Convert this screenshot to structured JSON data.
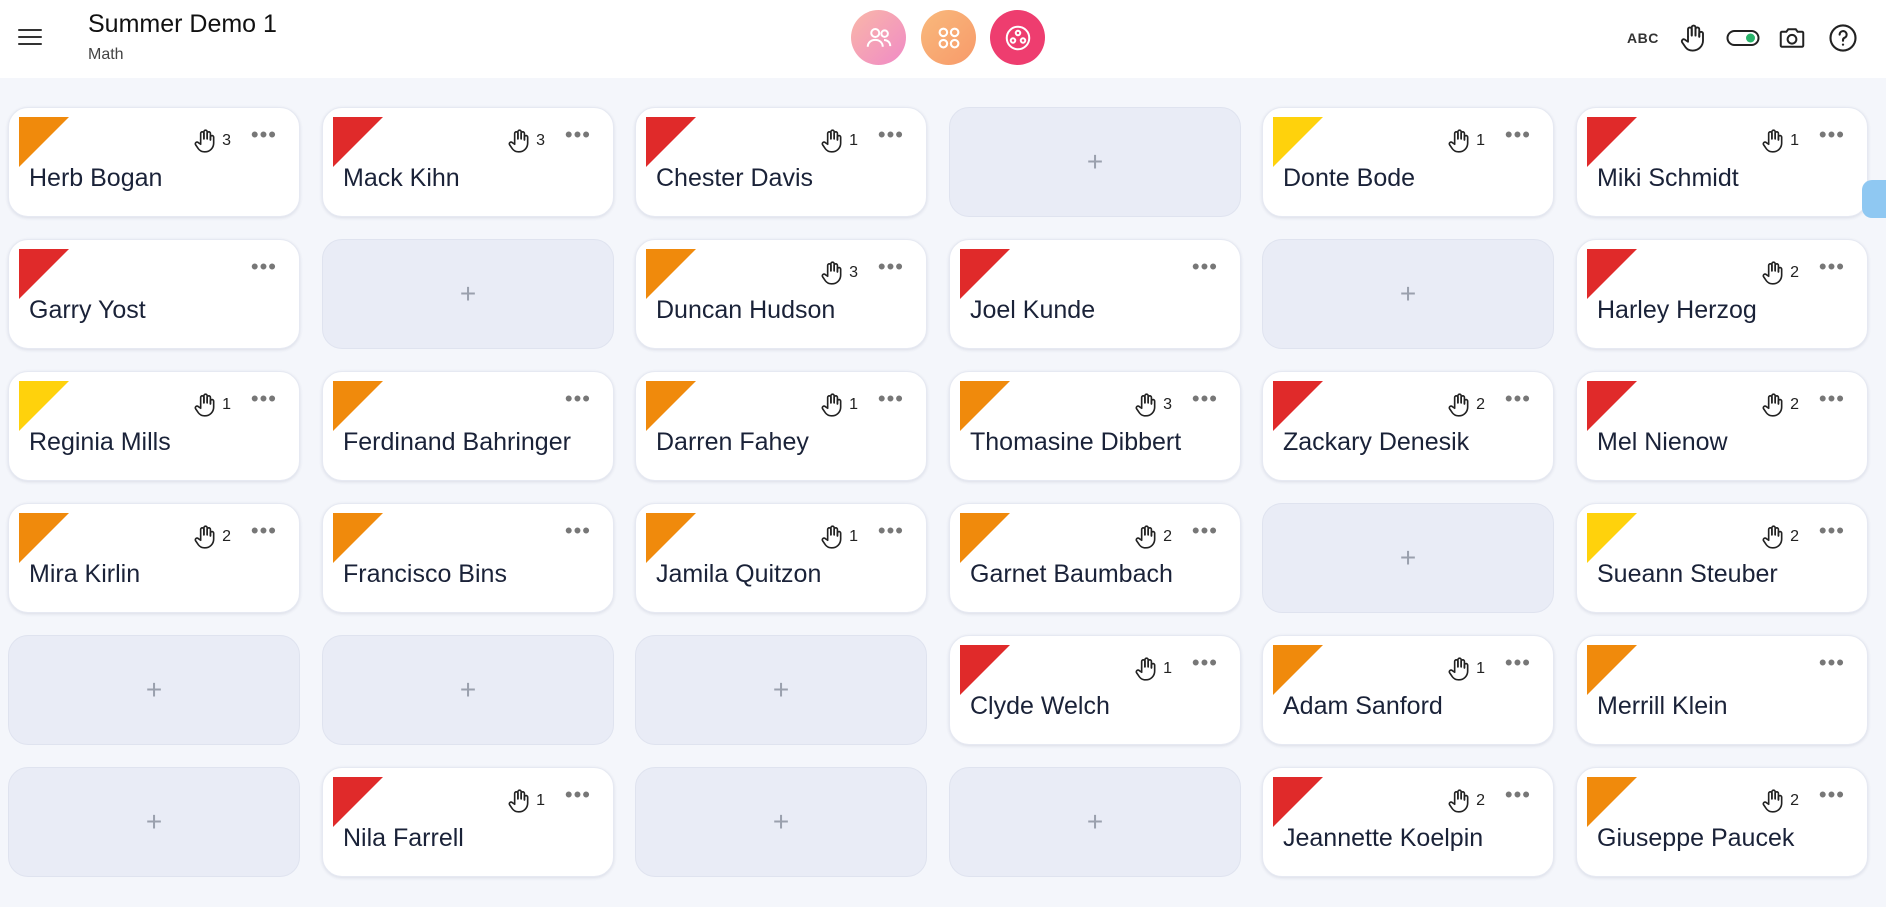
{
  "header": {
    "title": "Summer Demo 1",
    "subtitle": "Math"
  },
  "modes": [
    {
      "name": "students-mode-icon",
      "color": "#f6a5b7"
    },
    {
      "name": "groups-mode-icon",
      "color": "#f7a566"
    },
    {
      "name": "random-mode-icon",
      "color": "#ef3f72"
    }
  ],
  "tools": {
    "abc_label": "ABC"
  },
  "flag_colors": {
    "red": "#e02a2a",
    "orange": "#f08a0c",
    "yellow": "#ffd20c"
  },
  "rows": [
    [
      {
        "name": "Herb Bogan",
        "flag": "orange",
        "hands": "3"
      },
      {
        "name": "Mack Kihn",
        "flag": "red",
        "hands": "3"
      },
      {
        "name": "Chester Davis",
        "flag": "red",
        "hands": "1"
      },
      null,
      {
        "name": "Donte Bode",
        "flag": "yellow",
        "hands": "1"
      },
      {
        "name": "Miki Schmidt",
        "flag": "red",
        "hands": "1"
      }
    ],
    [
      {
        "name": "Garry Yost",
        "flag": "red",
        "hands": ""
      },
      null,
      {
        "name": "Duncan Hudson",
        "flag": "orange",
        "hands": "3"
      },
      {
        "name": "Joel Kunde",
        "flag": "red",
        "hands": ""
      },
      null,
      {
        "name": "Harley Herzog",
        "flag": "red",
        "hands": "2"
      }
    ],
    [
      {
        "name": "Reginia Mills",
        "flag": "yellow",
        "hands": "1"
      },
      {
        "name": "Ferdinand Bahringer",
        "flag": "orange",
        "hands": ""
      },
      {
        "name": "Darren Fahey",
        "flag": "orange",
        "hands": "1"
      },
      {
        "name": "Thomasine Dibbert",
        "flag": "orange",
        "hands": "3"
      },
      {
        "name": "Zackary Denesik",
        "flag": "red",
        "hands": "2"
      },
      {
        "name": "Mel Nienow",
        "flag": "red",
        "hands": "2"
      }
    ],
    [
      {
        "name": "Mira Kirlin",
        "flag": "orange",
        "hands": "2"
      },
      {
        "name": "Francisco Bins",
        "flag": "orange",
        "hands": ""
      },
      {
        "name": "Jamila Quitzon",
        "flag": "orange",
        "hands": "1"
      },
      {
        "name": "Garnet Baumbach",
        "flag": "orange",
        "hands": "2"
      },
      null,
      {
        "name": "Sueann Steuber",
        "flag": "yellow",
        "hands": "2"
      }
    ],
    [
      null,
      null,
      null,
      {
        "name": "Clyde Welch",
        "flag": "red",
        "hands": "1"
      },
      {
        "name": "Adam Sanford",
        "flag": "orange",
        "hands": "1"
      },
      {
        "name": "Merrill Klein",
        "flag": "orange",
        "hands": ""
      }
    ],
    [
      null,
      {
        "name": "Nila Farrell",
        "flag": "red",
        "hands": "1"
      },
      null,
      null,
      {
        "name": "Jeannette Koelpin",
        "flag": "red",
        "hands": "2"
      },
      {
        "name": "Giuseppe Paucek",
        "flag": "orange",
        "hands": "2"
      }
    ]
  ],
  "empty_label": "+",
  "more_label": "•••"
}
